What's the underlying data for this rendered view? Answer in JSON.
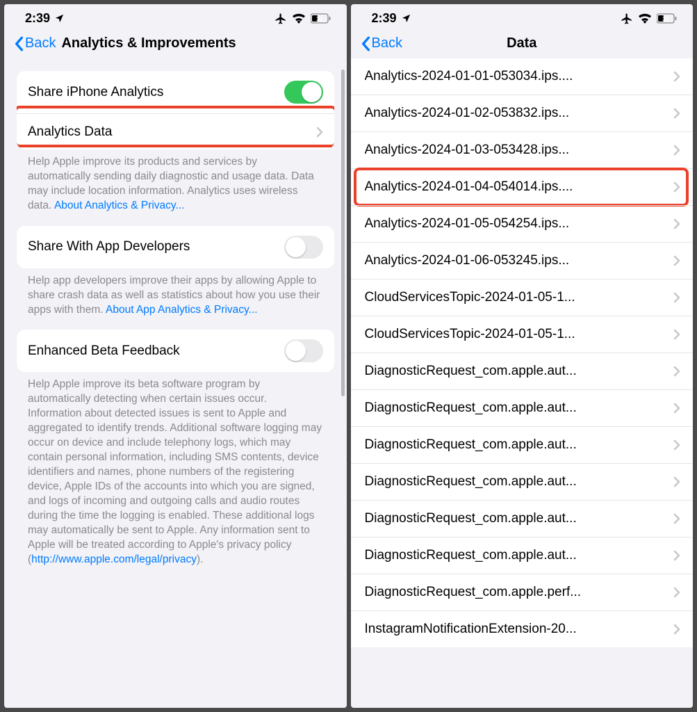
{
  "status": {
    "time": "2:39",
    "battery": "31"
  },
  "left": {
    "back": "Back",
    "title": "Analytics & Improvements",
    "rows": {
      "share_analytics": "Share iPhone Analytics",
      "analytics_data": "Analytics Data",
      "share_dev": "Share With App Developers",
      "beta": "Enhanced Beta Feedback"
    },
    "footers": {
      "f1a": "Help Apple improve its products and services by automatically sending daily diagnostic and usage data. Data may include location information. Analytics uses wireless data. ",
      "f1link": "About Analytics & Privacy...",
      "f2a": "Help app developers improve their apps by allowing Apple to share crash data as well as statistics about how you use their apps with them. ",
      "f2link": "About App Analytics & Privacy...",
      "f3a": "Help Apple improve its beta software program by automatically detecting when certain issues occur. Information about detected issues is sent to Apple and aggregated to identify trends. Additional software logging may occur on device and include telephony logs, which may contain personal information, including SMS contents, device identifiers and names, phone numbers of the registering device, Apple IDs of the accounts into which you are signed, and logs of incoming and outgoing calls and audio routes during the time the logging is enabled. These additional logs may automatically be sent to Apple. Any information sent to Apple will be treated according to Apple's privacy policy (",
      "f3link": "http://www.apple.com/legal/privacy",
      "f3b": ")."
    }
  },
  "right": {
    "back": "Back",
    "title": "Data",
    "items": [
      "Analytics-2024-01-01-053034.ips....",
      "Analytics-2024-01-02-053832.ips...",
      "Analytics-2024-01-03-053428.ips...",
      "Analytics-2024-01-04-054014.ips....",
      "Analytics-2024-01-05-054254.ips...",
      "Analytics-2024-01-06-053245.ips...",
      "CloudServicesTopic-2024-01-05-1...",
      "CloudServicesTopic-2024-01-05-1...",
      "DiagnosticRequest_com.apple.aut...",
      "DiagnosticRequest_com.apple.aut...",
      "DiagnosticRequest_com.apple.aut...",
      "DiagnosticRequest_com.apple.aut...",
      "DiagnosticRequest_com.apple.aut...",
      "DiagnosticRequest_com.apple.aut...",
      "DiagnosticRequest_com.apple.perf...",
      "InstagramNotificationExtension-20..."
    ],
    "highlight_index": 3
  }
}
